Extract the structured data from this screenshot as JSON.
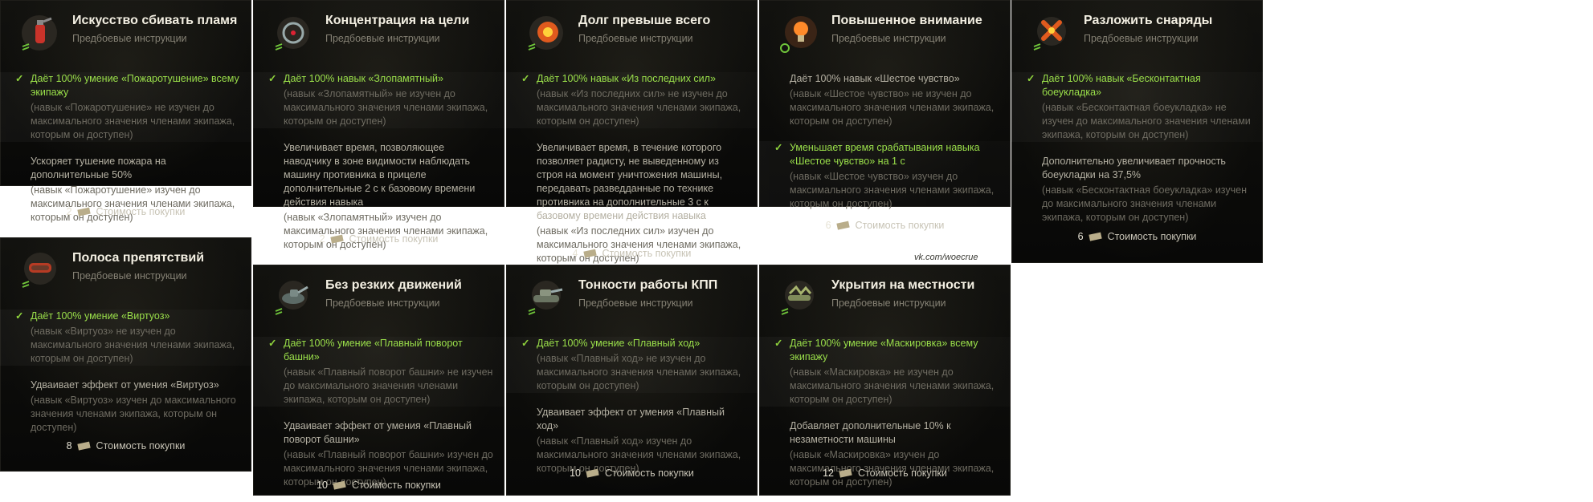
{
  "subtitle": "Предбоевые инструкции",
  "buy_label": "Стоимость покупки",
  "watermark": "vk.com/woecrue",
  "cards": [
    {
      "icon": "fire-extinguisher-icon",
      "title": "Искусство сбивать пламя",
      "sections": [
        {
          "checked": true,
          "effect": "Даёт 100% умение «Пожаротушение» всему экипажу",
          "note": "(навык «Пожаротушение» не изучен до максимального значения членами экипажа, которым он доступен)"
        },
        {
          "checked": false,
          "effect": "Ускоряет тушение пожара на дополнительные 50%",
          "note": "(навык «Пожаротушение» изучен до максимального значения членами экипажа, которым он доступен)"
        }
      ],
      "cost": "2"
    },
    {
      "icon": "sniper-scope-icon",
      "title": "Концентрация на цели",
      "sections": [
        {
          "checked": true,
          "effect": "Даёт 100% навык «Злопамятный»",
          "note": "(навык «Злопамятный» не изучен до максимального значения членами экипажа, которым он доступен)"
        },
        {
          "checked": false,
          "effect": "Увеличивает время, позволяющее наводчику в зоне видимости наблюдать машину противника в прицеле дополнительные 2 с к базовому времени действия навыка",
          "note": "(навык «Злопамятный» изучен до максимального значения членами экипажа, которым он доступен)"
        }
      ],
      "cost": "2"
    },
    {
      "icon": "radio-explosion-icon",
      "title": "Долг превыше всего",
      "sections": [
        {
          "checked": true,
          "effect": "Даёт 100% навык «Из последних сил»",
          "note": "(навык «Из последних сил» не изучен до максимального значения членами экипажа, которым он доступен)"
        },
        {
          "checked": false,
          "effect": "Увеличивает время, в течение которого позволяет радисту, не выведенному из строя на момент уничтожения машины, передавать разведданные по технике противника на дополнительные 3 с к базовому времени действия навыка",
          "note": "(навык «Из последних сил» изучен до максимального значения членами экипажа, которым он доступен)"
        }
      ],
      "cost": "4"
    },
    {
      "icon": "lightbulb-icon",
      "title": "Повышенное внимание",
      "sections": [
        {
          "checked": false,
          "effect": "Даёт 100% навык «Шестое чувство»",
          "note": "(навык «Шестое чувство» не изучен до максимального значения членами экипажа, которым он доступен)"
        },
        {
          "checked": true,
          "effect": "Уменьшает время срабатывания навыка «Шестое чувство» на 1 с",
          "note": "(навык «Шестое чувство» изучен до максимального значения членами экипажа, которым он доступен)"
        }
      ],
      "cost": "6"
    },
    {
      "icon": "shells-icon",
      "title": "Разложить снаряды",
      "sections": [
        {
          "checked": true,
          "effect": "Даёт 100% навык «Бесконтактная боеукладка»",
          "note": "(навык «Бесконтактная боеукладка» не изучен до максимального значения членами экипажа, которым он доступен)"
        },
        {
          "checked": false,
          "effect": "Дополнительно увеличивает прочность боеукладки на 37,5%",
          "note": "(навык «Бесконтактная боеукладка» изучен до максимального значения членами экипажа, которым он доступен)"
        }
      ],
      "cost": "6"
    },
    {
      "icon": "tank-track-icon",
      "title": "Полоса препятствий",
      "sections": [
        {
          "checked": true,
          "effect": "Даёт 100% умение «Виртуоз»",
          "note": "(навык «Виртуоз» не изучен до максимального значения членами экипажа, которым он доступен)"
        },
        {
          "checked": false,
          "effect": "Удваивает эффект от умения «Виртуоз»",
          "note": "(навык «Виртуоз» изучен до максимального значения членами экипажа, которым он доступен)"
        }
      ],
      "cost": "8"
    },
    {
      "icon": "turret-icon",
      "title": "Без резких движений",
      "sections": [
        {
          "checked": true,
          "effect": "Даёт 100% умение «Плавный поворот башни»",
          "note": "(навык «Плавный поворот башни» не изучен до максимального значения членами экипажа, которым он доступен)"
        },
        {
          "checked": false,
          "effect": "Удваивает эффект от умения «Плавный поворот башни»",
          "note": "(навык «Плавный поворот башни» изучен до максимального значения членами экипажа, которым он доступен)"
        }
      ],
      "cost": "10"
    },
    {
      "icon": "tank-icon",
      "title": "Тонкости работы КПП",
      "sections": [
        {
          "checked": true,
          "effect": "Даёт 100% умение «Плавный ход»",
          "note": "(навык «Плавный ход» не изучен до максимального значения членами экипажа, которым он доступен)"
        },
        {
          "checked": false,
          "effect": "Удваивает эффект от умения «Плавный ход»",
          "note": "(навык «Плавный ход» изучен до максимального значения членами экипажа, которым он доступен)"
        }
      ],
      "cost": "10"
    },
    {
      "icon": "camouflage-icon",
      "title": "Укрытия на местности",
      "sections": [
        {
          "checked": true,
          "effect": "Даёт 100% умение «Маскировка» всему экипажу",
          "note": "(навык «Маскировка» не изучен до максимального значения членами экипажа, которым он доступен)"
        },
        {
          "checked": false,
          "effect": "Добавляет дополнительные 10% к незаметности машины",
          "note": "(навык «Маскировка» изучен до максимального значения членами экипажа, которым он доступен)"
        }
      ],
      "cost": "12"
    }
  ]
}
